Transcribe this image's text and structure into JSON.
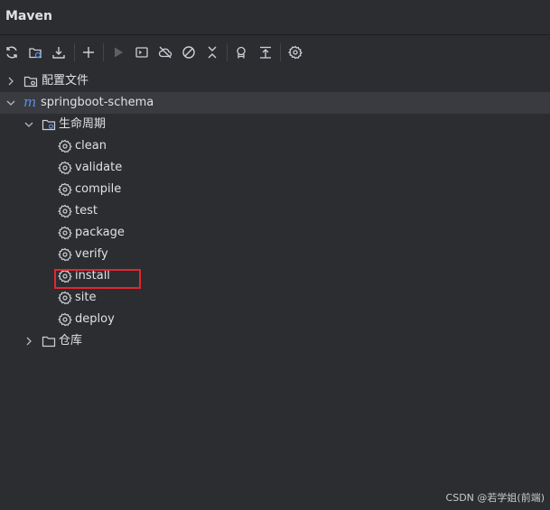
{
  "window": {
    "title": "Maven"
  },
  "toolbar": {
    "buttons": [
      {
        "name": "reload-icon"
      },
      {
        "name": "generate-sources-icon"
      },
      {
        "name": "download-icon"
      },
      {
        "name": "add-icon"
      },
      {
        "name": "run-icon"
      },
      {
        "name": "run-config-icon"
      },
      {
        "name": "offline-icon"
      },
      {
        "name": "skip-tests-icon"
      },
      {
        "name": "collapse-icon"
      },
      {
        "name": "analyze-icon"
      },
      {
        "name": "expand-all-icon"
      },
      {
        "name": "settings-icon"
      }
    ]
  },
  "tree": {
    "config_files": "配置文件",
    "project": "springboot-schema",
    "project_prefix": "m",
    "lifecycle": "生命周期",
    "phases": [
      "clean",
      "validate",
      "compile",
      "test",
      "package",
      "verify",
      "install",
      "site",
      "deploy"
    ],
    "repositories": "仓库"
  },
  "watermark": "CSDN @若学姐(前端)",
  "colors": {
    "background": "#2b2d30",
    "selected_row": "#393b40",
    "highlight": "#e4262f",
    "maven_accent": "#5a8de6"
  }
}
